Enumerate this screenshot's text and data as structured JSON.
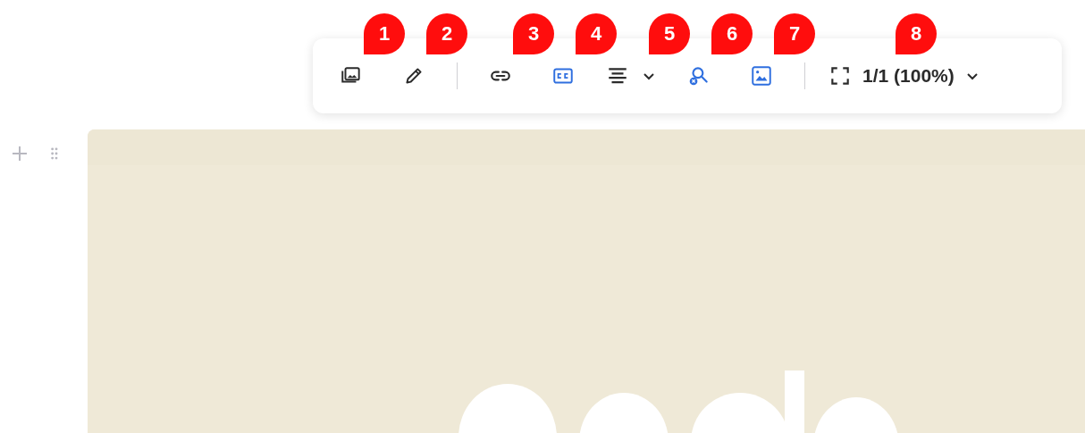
{
  "toolbar": {
    "groups": [
      [
        {
          "kind": "icon",
          "active": false,
          "callout": "1"
        },
        {
          "kind": "icon",
          "active": false,
          "callout": "2"
        }
      ],
      [
        {
          "kind": "icon",
          "active": false,
          "callout": "3"
        },
        {
          "kind": "icon",
          "active": true,
          "callout": "4"
        },
        {
          "kind": "dropdown",
          "active": false,
          "callout": "5"
        },
        {
          "kind": "icon",
          "active": true,
          "callout": "6"
        },
        {
          "kind": "icon",
          "active": true,
          "callout": "7"
        }
      ],
      [
        {
          "kind": "zoom",
          "active": false,
          "callout": "8",
          "label": "1/1 (100%)"
        }
      ]
    ]
  }
}
